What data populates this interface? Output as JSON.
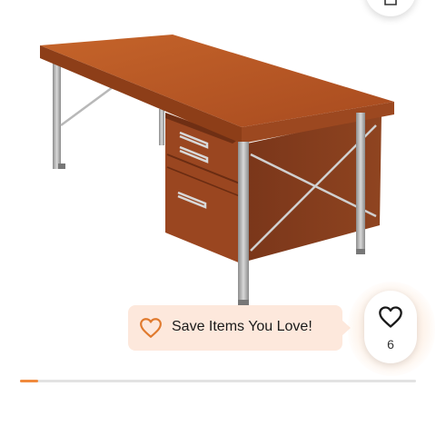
{
  "tooltip": {
    "text": "Save Items You Love!"
  },
  "favorite": {
    "count": "6"
  },
  "gallery": {
    "progress": 0.046
  },
  "colors": {
    "accent": "#f08a3c",
    "tooltip_bg": "#fde8dc"
  },
  "icons": {
    "top": "share-icon",
    "tooltip": "heart-outline-icon",
    "favorite": "heart-icon"
  }
}
